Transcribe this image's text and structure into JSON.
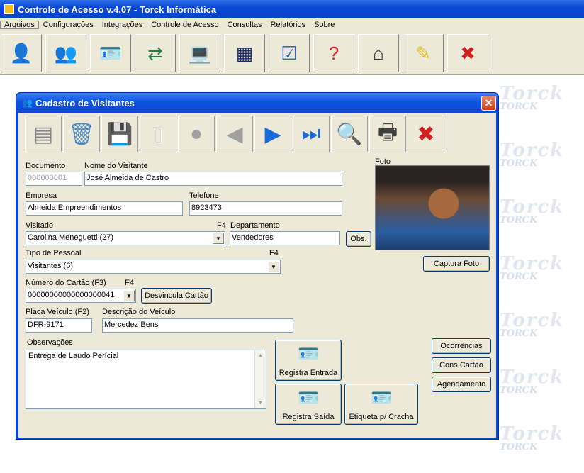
{
  "app": {
    "title": "Controle de Acesso v.4.07 - Torck Informática"
  },
  "menu": [
    "Arquivos",
    "Configurações",
    "Integrações",
    "Controle de Acesso",
    "Consultas",
    "Relatórios",
    "Sobre"
  ],
  "watermark": {
    "logo": "Torck",
    "tagline": "TORCK"
  },
  "dialog": {
    "title": "Cadastro de Visitantes",
    "fields": {
      "documento": {
        "label": "Documento",
        "value": "000000001"
      },
      "nome": {
        "label": "Nome do Visitante",
        "value": "José Almeida de Castro"
      },
      "empresa": {
        "label": "Empresa",
        "value": "Almeida Empreendimentos"
      },
      "telefone": {
        "label": "Telefone",
        "value": "8923473"
      },
      "visitado": {
        "label": "Visitado",
        "hint": "F4",
        "value": "Carolina Meneguetti (27)"
      },
      "departamento": {
        "label": "Departamento",
        "value": "Vendedores"
      },
      "tipo": {
        "label": "Tipo de Pessoal",
        "hint": "F4",
        "value": "Visitantes (6)"
      },
      "cartao": {
        "label": "Número do Cartão (F3)",
        "hint": "F4",
        "value": "00000000000000000041"
      },
      "placa": {
        "label": "Placa Veículo (F2)",
        "value": "DFR-9171"
      },
      "descricao": {
        "label": "Descrição do Veículo",
        "value": "Mercedez Bens"
      },
      "observacoes": {
        "label": "Observações",
        "value": "Entrega de Laudo Perícial"
      }
    },
    "foto_label": "Foto",
    "buttons": {
      "obs": "Obs.",
      "captura": "Captura Foto",
      "desvincula": "Desvincula Cartão",
      "registra_entrada": "Registra Entrada",
      "registra_saida": "Registra Saída",
      "etiqueta": "Etiqueta p/ Cracha",
      "ocorrencias": "Ocorrências",
      "cons_cartao": "Cons.Cartão",
      "agendamento": "Agendamento"
    }
  }
}
